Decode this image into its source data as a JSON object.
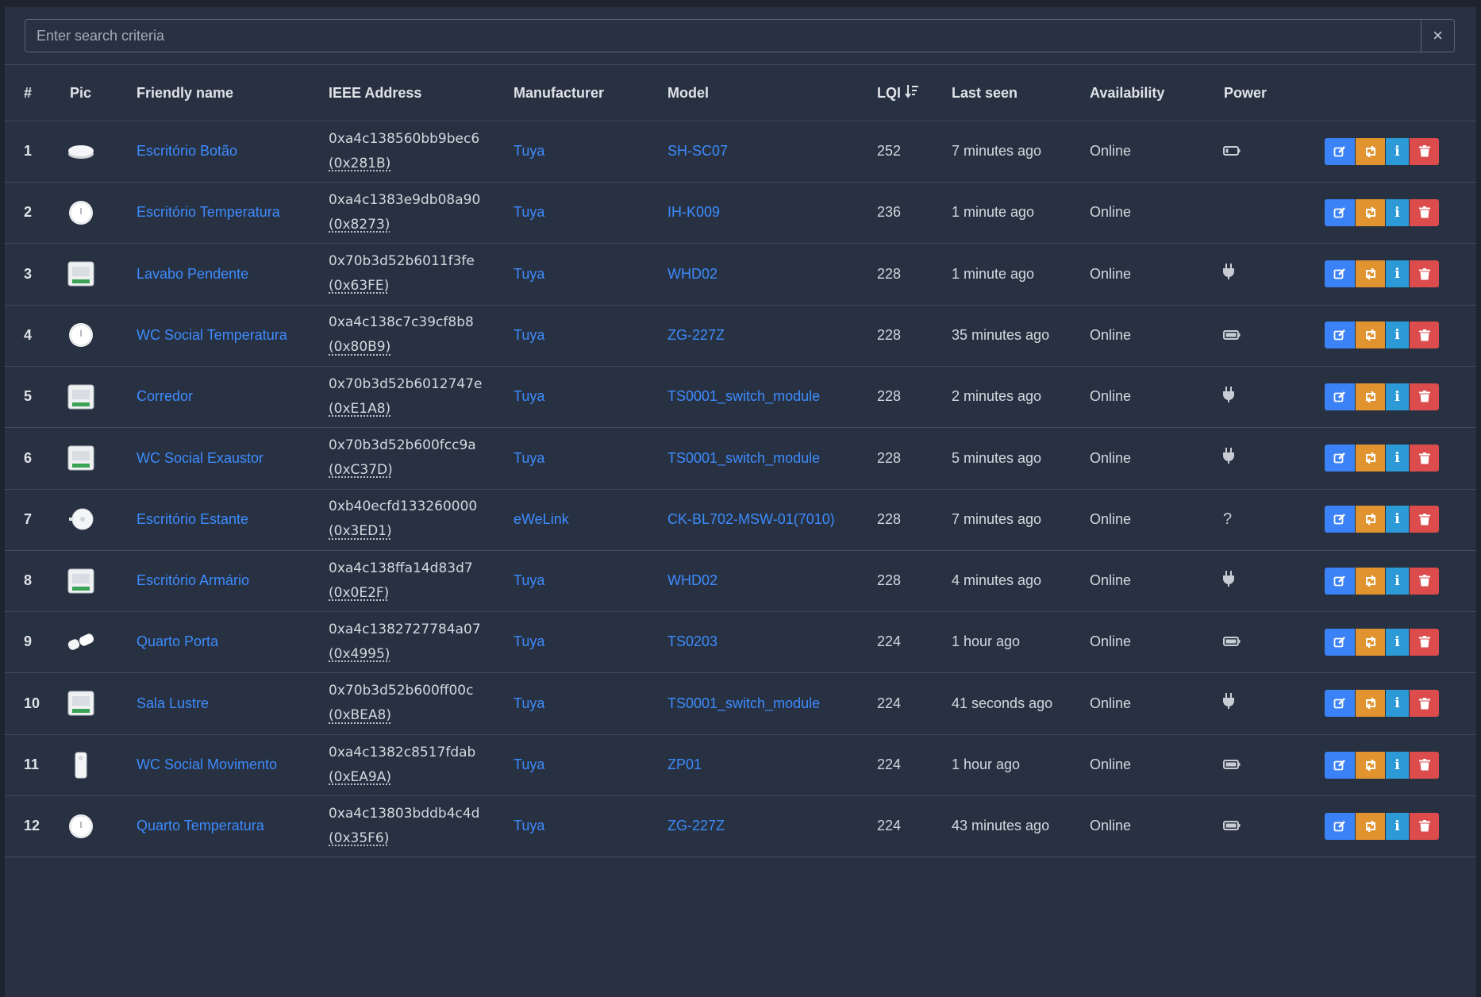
{
  "search": {
    "placeholder": "Enter search criteria",
    "clear_label": "×"
  },
  "columns": {
    "num": "#",
    "pic": "Pic",
    "friendly_name": "Friendly name",
    "ieee": "IEEE Address",
    "manufacturer": "Manufacturer",
    "model": "Model",
    "lqi": "LQI",
    "last_seen": "Last seen",
    "availability": "Availability",
    "power": "Power"
  },
  "colors": {
    "edit": "#3b82f6",
    "reconfigure": "#e0932f",
    "info": "#2c9ad6",
    "delete": "#dc4c4c",
    "link": "#3d8bfd"
  },
  "rows": [
    {
      "num": "1",
      "name": "Escritório Botão",
      "ieee": "0xa4c138560bb9bec6",
      "nwk": "(0x281B)",
      "manufacturer": "Tuya",
      "model": "SH-SC07",
      "lqi": "252",
      "last_seen": "7 minutes ago",
      "availability": "Online",
      "power": "battery-low",
      "pic": "button-device"
    },
    {
      "num": "2",
      "name": "Escritório Temperatura",
      "ieee": "0xa4c1383e9db08a90",
      "nwk": "(0x8273)",
      "manufacturer": "Tuya",
      "model": "IH-K009",
      "lqi": "236",
      "last_seen": "1 minute ago",
      "availability": "Online",
      "power": "none",
      "pic": "round-sensor"
    },
    {
      "num": "3",
      "name": "Lavabo Pendente",
      "ieee": "0x70b3d52b6011f3fe",
      "nwk": "(0x63FE)",
      "manufacturer": "Tuya",
      "model": "WHD02",
      "lqi": "228",
      "last_seen": "1 minute ago",
      "availability": "Online",
      "power": "plug",
      "pic": "switch-module"
    },
    {
      "num": "4",
      "name": "WC Social Temperatura",
      "ieee": "0xa4c138c7c39cf8b8",
      "nwk": "(0x80B9)",
      "manufacturer": "Tuya",
      "model": "ZG-227Z",
      "lqi": "228",
      "last_seen": "35 minutes ago",
      "availability": "Online",
      "power": "battery",
      "pic": "round-sensor"
    },
    {
      "num": "5",
      "name": "Corredor",
      "ieee": "0x70b3d52b6012747e",
      "nwk": "(0xE1A8)",
      "manufacturer": "Tuya",
      "model": "TS0001_switch_module",
      "lqi": "228",
      "last_seen": "2 minutes ago",
      "availability": "Online",
      "power": "plug",
      "pic": "switch-module"
    },
    {
      "num": "6",
      "name": "WC Social Exaustor",
      "ieee": "0x70b3d52b600fcc9a",
      "nwk": "(0xC37D)",
      "manufacturer": "Tuya",
      "model": "TS0001_switch_module",
      "lqi": "228",
      "last_seen": "5 minutes ago",
      "availability": "Online",
      "power": "plug",
      "pic": "switch-module"
    },
    {
      "num": "7",
      "name": "Escritório Estante",
      "ieee": "0xb40ecfd133260000",
      "nwk": "(0x3ED1)",
      "manufacturer": "eWeLink",
      "model": "CK-BL702-MSW-01(7010)",
      "lqi": "228",
      "last_seen": "7 minutes ago",
      "availability": "Online",
      "power": "unknown",
      "pic": "plug-device"
    },
    {
      "num": "8",
      "name": "Escritório Armário",
      "ieee": "0xa4c138ffa14d83d7",
      "nwk": "(0x0E2F)",
      "manufacturer": "Tuya",
      "model": "WHD02",
      "lqi": "228",
      "last_seen": "4 minutes ago",
      "availability": "Online",
      "power": "plug",
      "pic": "switch-module"
    },
    {
      "num": "9",
      "name": "Quarto Porta",
      "ieee": "0xa4c1382727784a07",
      "nwk": "(0x4995)",
      "manufacturer": "Tuya",
      "model": "TS0203",
      "lqi": "224",
      "last_seen": "1 hour ago",
      "availability": "Online",
      "power": "battery",
      "pic": "door-sensor"
    },
    {
      "num": "10",
      "name": "Sala Lustre",
      "ieee": "0x70b3d52b600ff00c",
      "nwk": "(0xBEA8)",
      "manufacturer": "Tuya",
      "model": "TS0001_switch_module",
      "lqi": "224",
      "last_seen": "41 seconds ago",
      "availability": "Online",
      "power": "plug",
      "pic": "switch-module"
    },
    {
      "num": "11",
      "name": "WC Social Movimento",
      "ieee": "0xa4c1382c8517fdab",
      "nwk": "(0xEA9A)",
      "manufacturer": "Tuya",
      "model": "ZP01",
      "lqi": "224",
      "last_seen": "1 hour ago",
      "availability": "Online",
      "power": "battery",
      "pic": "motion-sensor"
    },
    {
      "num": "12",
      "name": "Quarto Temperatura",
      "ieee": "0xa4c13803bddb4c4d",
      "nwk": "(0x35F6)",
      "manufacturer": "Tuya",
      "model": "ZG-227Z",
      "lqi": "224",
      "last_seen": "43 minutes ago",
      "availability": "Online",
      "power": "battery",
      "pic": "round-sensor"
    }
  ]
}
